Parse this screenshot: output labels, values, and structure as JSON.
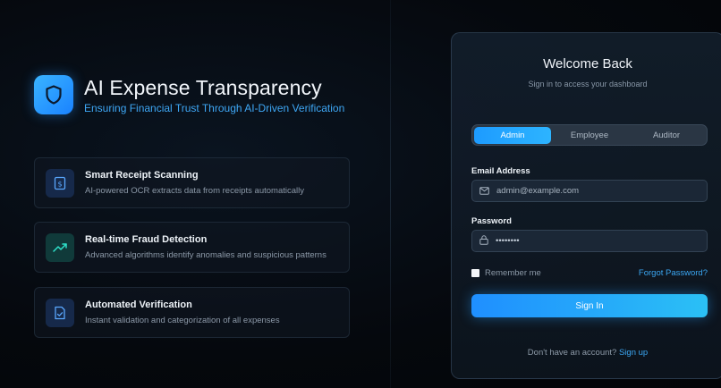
{
  "brand": {
    "title": "AI Expense Transparency",
    "subtitle": "Ensuring Financial Trust Through AI-Driven Verification",
    "logo_icon": "shield-icon",
    "accent": "#3ea7f5"
  },
  "features": [
    {
      "icon": "receipt-icon",
      "title": "Smart Receipt Scanning",
      "description": "AI-powered OCR extracts data from receipts automatically"
    },
    {
      "icon": "trending-up-icon",
      "title": "Real-time Fraud Detection",
      "description": "Advanced algorithms identify anomalies and suspicious patterns"
    },
    {
      "icon": "file-check-icon",
      "title": "Automated Verification",
      "description": "Instant validation and categorization of all expenses"
    }
  ],
  "login": {
    "title": "Welcome Back",
    "subtitle": "Sign in to access your dashboard",
    "roles": [
      "Admin",
      "Employee",
      "Auditor"
    ],
    "selected_role": "Admin",
    "email_label": "Email Address",
    "email_placeholder": "admin@example.com",
    "email_icon": "mail-icon",
    "password_label": "Password",
    "password_value": "••••••••",
    "password_icon": "lock-icon",
    "remember_label": "Remember me",
    "forgot_label": "Forgot Password?",
    "signin_label": "Sign In",
    "signup_prompt": "Don't have an account?",
    "signup_label": "Sign up"
  }
}
